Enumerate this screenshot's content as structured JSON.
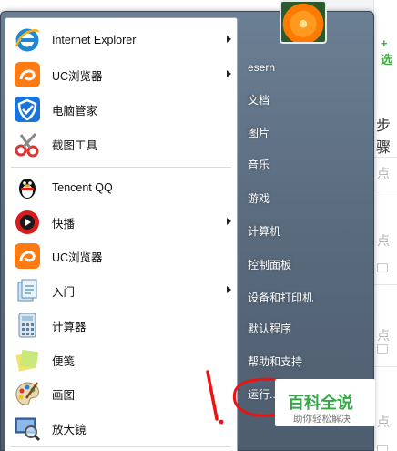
{
  "background": {
    "plus_glyph": "+ 选",
    "step_text": "步骤",
    "hint_text": "点",
    "accent": "#3fae3f"
  },
  "programs": [
    {
      "label": "Internet Explorer",
      "icon": "ie-icon",
      "has_arrow": true
    },
    {
      "label": "UC浏览器",
      "icon": "uc-browser-icon",
      "has_arrow": true
    },
    {
      "label": "电脑管家",
      "icon": "pc-manager-shield-icon",
      "has_arrow": false
    },
    {
      "label": "截图工具",
      "icon": "scissors-icon",
      "has_arrow": false
    },
    {
      "label": "Tencent QQ",
      "icon": "qq-penguin-icon",
      "has_arrow": false
    },
    {
      "label": "快播",
      "icon": "qvod-player-icon",
      "has_arrow": true
    },
    {
      "label": "UC浏览器",
      "icon": "uc-browser-icon",
      "has_arrow": false
    },
    {
      "label": "入门",
      "icon": "getting-started-icon",
      "has_arrow": true
    },
    {
      "label": "计算器",
      "icon": "calculator-icon",
      "has_arrow": false
    },
    {
      "label": "便笺",
      "icon": "sticky-notes-icon",
      "has_arrow": false
    },
    {
      "label": "画图",
      "icon": "paint-palette-icon",
      "has_arrow": false
    },
    {
      "label": "放大镜",
      "icon": "magnifier-icon",
      "has_arrow": false
    }
  ],
  "right_menu": {
    "user": "esern",
    "items": [
      "文档",
      "图片",
      "音乐",
      "游戏",
      "计算机",
      "控制面板",
      "设备和打印机",
      "默认程序",
      "帮助和支持",
      "运行..."
    ]
  },
  "annotation": {
    "text": "1.",
    "color": "#ee1111"
  },
  "watermark": {
    "title": "百科全说",
    "subtitle": "助你轻松解决"
  }
}
